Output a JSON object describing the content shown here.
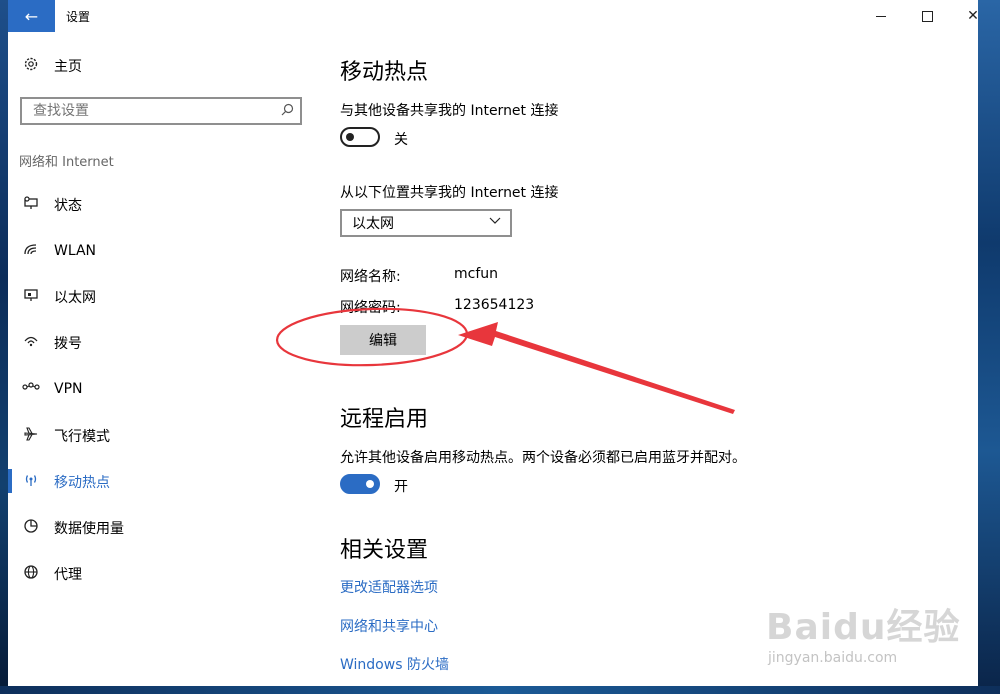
{
  "window": {
    "title": "设置",
    "back_glyph": "←",
    "close_glyph": "✕"
  },
  "sidebar": {
    "home_label": "主页",
    "search_placeholder": "查找设置",
    "section_label": "网络和 Internet",
    "items": [
      {
        "label": "状态",
        "icon": "status-icon"
      },
      {
        "label": "WLAN",
        "icon": "wlan-icon"
      },
      {
        "label": "以太网",
        "icon": "ethernet-icon"
      },
      {
        "label": "拨号",
        "icon": "dialup-icon"
      },
      {
        "label": "VPN",
        "icon": "vpn-icon"
      },
      {
        "label": "飞行模式",
        "icon": "airplane-icon"
      },
      {
        "label": "移动热点",
        "icon": "hotspot-icon",
        "active": true
      },
      {
        "label": "数据使用量",
        "icon": "data-usage-icon"
      },
      {
        "label": "代理",
        "icon": "proxy-icon"
      }
    ]
  },
  "main": {
    "hotspot": {
      "heading": "移动热点",
      "share_label": "与其他设备共享我的 Internet 连接",
      "share_toggle_state": "关",
      "source_label": "从以下位置共享我的 Internet 连接",
      "source_value": "以太网",
      "name_label": "网络名称:",
      "name_value": "mcfun",
      "password_label": "网络密码:",
      "password_value": "123654123",
      "edit_button": "编辑"
    },
    "remote": {
      "heading": "远程启用",
      "description": "允许其他设备启用移动热点。两个设备必须都已启用蓝牙并配对。",
      "toggle_state": "开"
    },
    "related": {
      "heading": "相关设置",
      "links": [
        "更改适配器选项",
        "网络和共享中心",
        "Windows 防火墙"
      ]
    }
  },
  "watermark": {
    "logo": "Baidu经验",
    "url": "jingyan.baidu.com"
  },
  "colors": {
    "accent": "#2b6cc4",
    "annotation": "#e8363c"
  }
}
